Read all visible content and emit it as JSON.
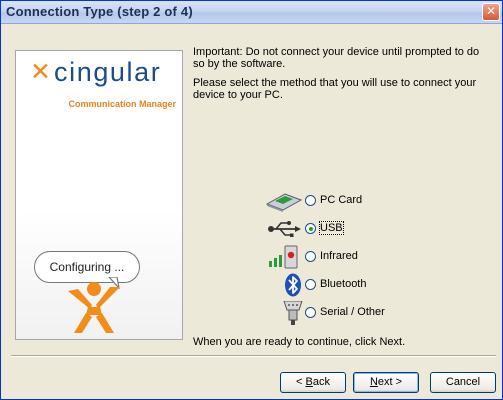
{
  "window": {
    "title": "Connection Type (step 2 of 4)",
    "close_glyph": "✕"
  },
  "brand": {
    "logo_mark": "✕",
    "logo_text": "cingular",
    "logo_subtitle": "Communication Manager",
    "status_bubble": "Configuring ..."
  },
  "instructions": {
    "important": "Important:  Do not connect your device until prompted to do so by the software.",
    "prompt": "Please select the method that you will use to connect your device to your PC."
  },
  "options": [
    {
      "id": "pc-card",
      "label": "PC Card",
      "icon": "pc-card-icon",
      "selected": false
    },
    {
      "id": "usb",
      "label": "USB",
      "icon": "usb-icon",
      "selected": true
    },
    {
      "id": "infrared",
      "label": "Infrared",
      "icon": "infrared-icon",
      "selected": false
    },
    {
      "id": "bluetooth",
      "label": "Bluetooth",
      "icon": "bluetooth-icon",
      "selected": false
    },
    {
      "id": "serial",
      "label": "Serial / Other",
      "icon": "serial-port-icon",
      "selected": false
    }
  ],
  "footer_text": "When you are ready to continue, click Next.",
  "buttons": {
    "back": {
      "prefix": "< ",
      "accel": "B",
      "rest": "ack"
    },
    "next": {
      "accel": "N",
      "rest": "ext >"
    },
    "cancel": "Cancel"
  },
  "colors": {
    "brand_blue": "#1c4d8b",
    "brand_orange": "#f28c1a",
    "title_bar": "#c5d5f0",
    "dialog_bg": "#ece9d8"
  }
}
